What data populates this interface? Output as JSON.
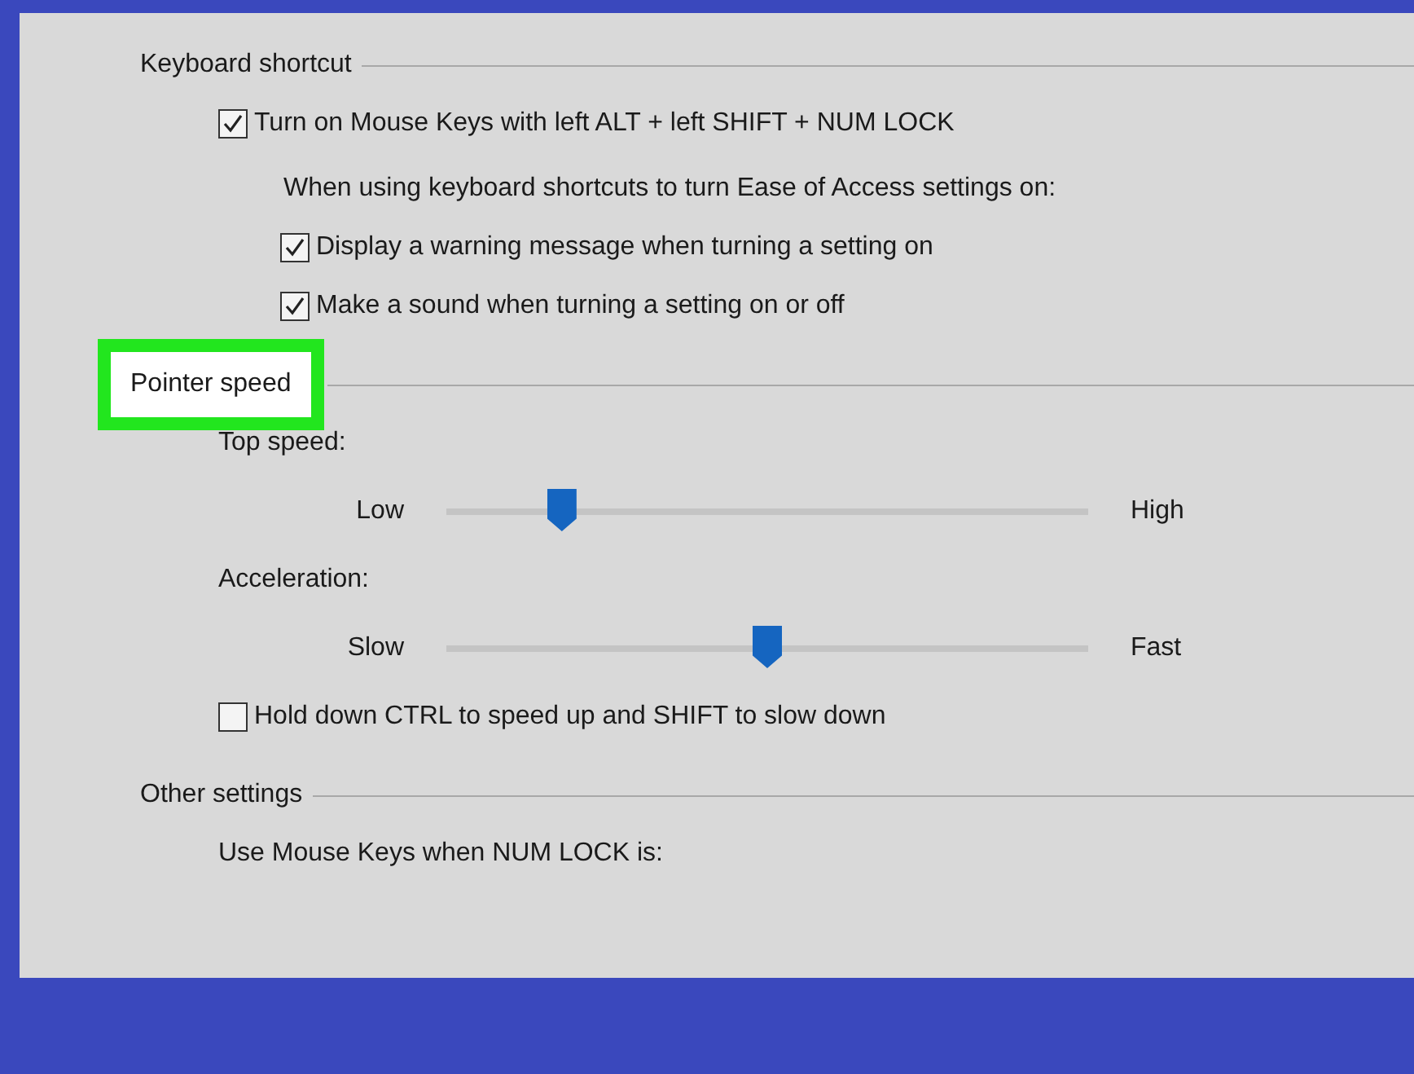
{
  "sections": [
    {
      "title": "Keyboard shortcut",
      "highlighted": false,
      "items": [
        {
          "kind": "checkbox",
          "label": "Turn on Mouse Keys with left ALT + left SHIFT + NUM LOCK",
          "checked": true,
          "indent": false
        },
        {
          "kind": "text",
          "label": "When using keyboard shortcuts to turn Ease of Access settings on:"
        },
        {
          "kind": "checkbox",
          "label": "Display a warning message when turning a setting on",
          "checked": true,
          "indent": true
        },
        {
          "kind": "checkbox",
          "label": "Make a sound when turning a setting on or off",
          "checked": true,
          "indent": true
        }
      ]
    },
    {
      "title": "Pointer speed",
      "highlighted": true,
      "items": [
        {
          "kind": "label",
          "label": "Top speed:"
        },
        {
          "kind": "slider",
          "min_label": "Low",
          "max_label": "High",
          "level": 0.18
        },
        {
          "kind": "label",
          "label": "Acceleration:"
        },
        {
          "kind": "slider",
          "min_label": "Slow",
          "max_label": "Fast",
          "level": 0.5
        },
        {
          "kind": "checkbox",
          "label": "Hold down CTRL to speed up and SHIFT to slow down",
          "checked": false,
          "indent": false
        }
      ]
    },
    {
      "title": "Other settings",
      "highlighted": false,
      "items": [
        {
          "kind": "label",
          "label": "Use Mouse Keys when NUM LOCK is:"
        }
      ]
    }
  ]
}
